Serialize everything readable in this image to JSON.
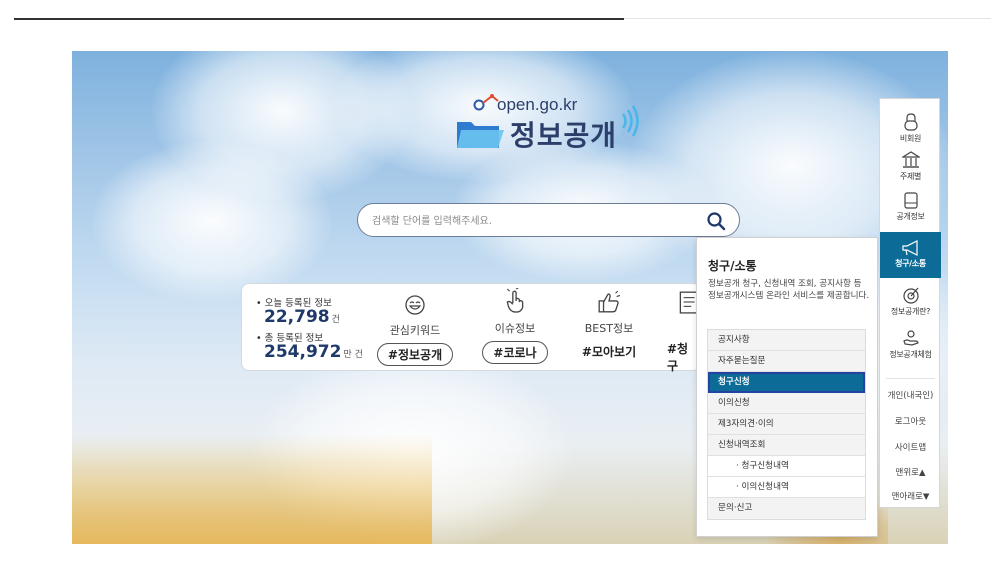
{
  "logo": {
    "url": "open.go.kr",
    "title": "정보공개"
  },
  "search": {
    "placeholder": "검색할 단어를 입력해주세요."
  },
  "stats": {
    "today_label": "• 오늘 등록된 정보",
    "today_value": "22,798",
    "today_unit": "건",
    "total_label": "• 총 등록된 정보",
    "total_value": "254,972",
    "total_unit": "만 건"
  },
  "keywords": [
    {
      "label": "관심키워드",
      "tag": "#정보공개",
      "icon": "smile-icon"
    },
    {
      "label": "이슈정보",
      "tag": "#코로나",
      "icon": "pointer-hand-icon"
    },
    {
      "label": "BEST정보",
      "tag": "#모아보기",
      "icon": "thumbs-up-icon"
    },
    {
      "label": "",
      "tag": "#청구",
      "icon": "document-icon"
    }
  ],
  "dropdown": {
    "title": "청구/소통",
    "desc": "정보공개 청구, 신청내역 조회, 공지사항 등 정보공개시스템 온라인 서비스를 제공합니다.",
    "items": [
      {
        "label": "공지사항"
      },
      {
        "label": "자주묻는질문"
      },
      {
        "label": "청구신청"
      },
      {
        "label": "이의신청"
      },
      {
        "label": "제3자의견·이의"
      },
      {
        "label": "신청내역조회"
      },
      {
        "label": "· 청구신청내역"
      },
      {
        "label": "· 이의신청내역"
      },
      {
        "label": "문의·신고"
      }
    ]
  },
  "quickbar": {
    "items": [
      {
        "label": "비회원",
        "icon": "lock-icon"
      },
      {
        "label": "주제별",
        "icon": "building-icon"
      },
      {
        "label": "공개정보",
        "icon": "folder-icon"
      },
      {
        "label": "청구/소통",
        "icon": "megaphone-icon"
      },
      {
        "label": "정보공개란?",
        "icon": "target-icon"
      },
      {
        "label": "정보공개체험",
        "icon": "hand-person-icon"
      }
    ],
    "links": [
      "개인(내국인)",
      "로그아웃",
      "사이트맵",
      "맨위로▲",
      "맨아래로▼"
    ]
  },
  "colors": {
    "accent": "#0c6c97",
    "navy": "#1f3969",
    "highlight_border": "#2342a4"
  }
}
